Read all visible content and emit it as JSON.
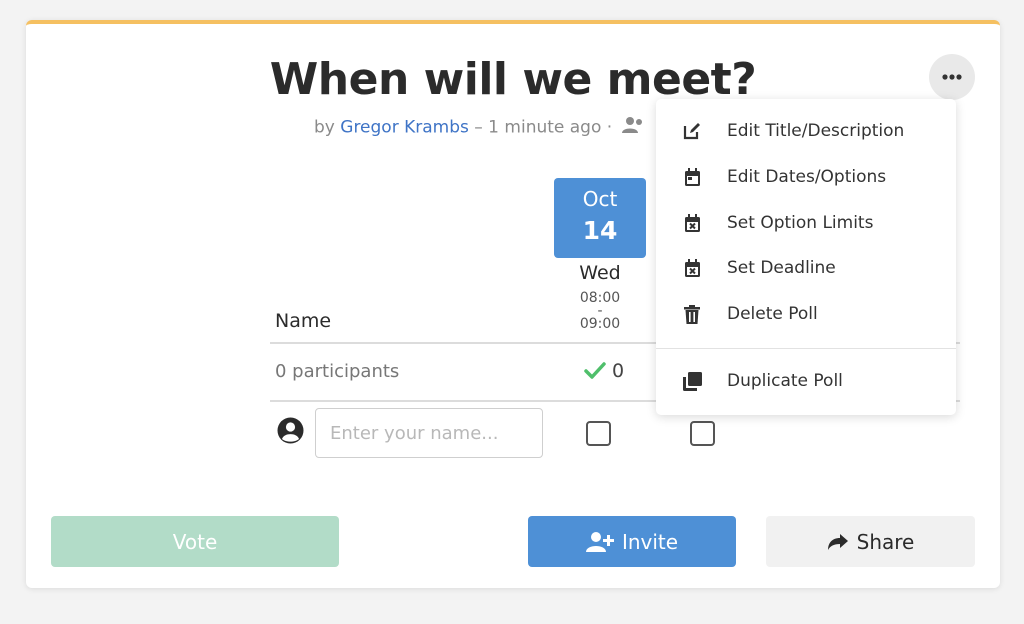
{
  "poll": {
    "title": "When will we meet?",
    "by": "by",
    "author": "Gregor Krambs",
    "time_ago": "– 1 minute ago ·"
  },
  "option": {
    "month": "Oct",
    "day": "14",
    "weekday": "Wed",
    "time_start": "08:00",
    "time_sep": "-",
    "time_end": "09:00"
  },
  "table": {
    "name_header": "Name",
    "participants": "0 participants",
    "count": "0",
    "name_placeholder": "Enter your name..."
  },
  "buttons": {
    "vote": "Vote",
    "invite": "Invite",
    "share": "Share"
  },
  "menu": {
    "items": [
      {
        "label": "Edit Title/Description",
        "icon": "edit-icon"
      },
      {
        "label": "Edit Dates/Options",
        "icon": "calendar-icon"
      },
      {
        "label": "Set Option Limits",
        "icon": "calendar-x-icon"
      },
      {
        "label": "Set Deadline",
        "icon": "calendar-x-icon"
      },
      {
        "label": "Delete Poll",
        "icon": "trash-icon"
      },
      {
        "label": "Duplicate Poll",
        "icon": "copy-icon"
      }
    ]
  },
  "colors": {
    "accent_top": "#f5c061",
    "primary": "#4e90d6",
    "vote_disabled": "#b2dcc8",
    "check_green": "#4fbf6b",
    "link": "#3f74c6"
  }
}
